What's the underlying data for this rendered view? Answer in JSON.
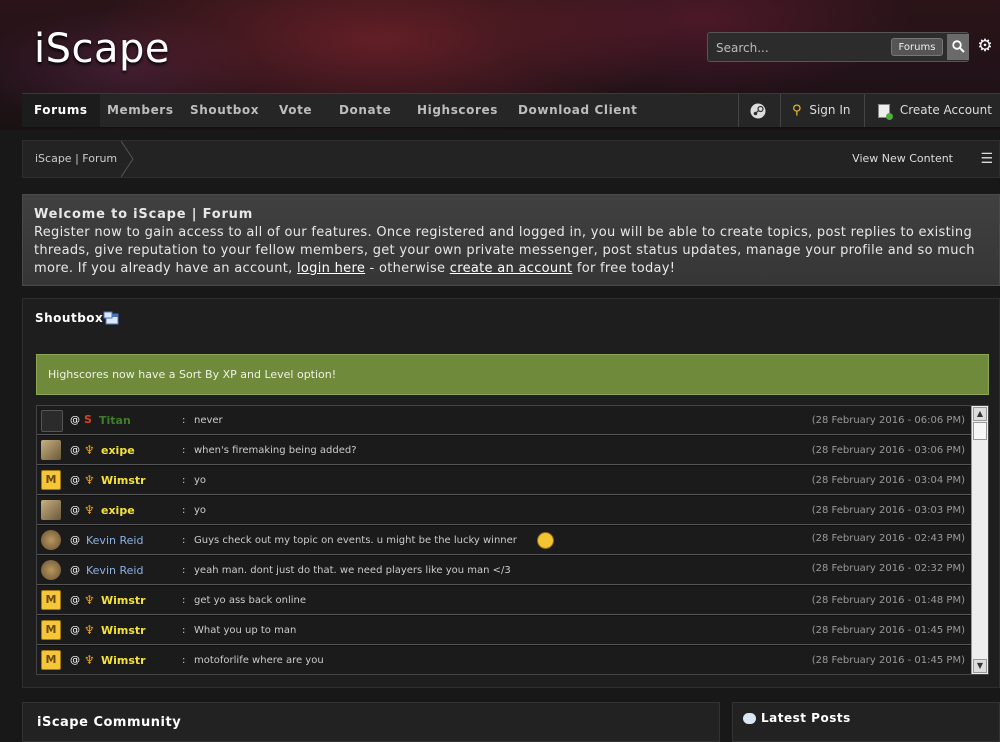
{
  "site": {
    "logo": "iScape"
  },
  "search": {
    "placeholder": "Search...",
    "scope": "Forums"
  },
  "nav": {
    "items": [
      "Forums",
      "Members",
      "Shoutbox",
      "Vote",
      "Donate",
      "Highscores",
      "Download Client"
    ],
    "sign_in": "Sign In",
    "create_account": "Create Account"
  },
  "breadcrumb": {
    "current": "iScape | Forum",
    "view_new": "View New Content"
  },
  "welcome": {
    "title": "Welcome to iScape | Forum",
    "line1": "Register now to gain access to all of our features. Once registered and logged in, you will be able to create topics, post replies to existing",
    "line2": "threads, give reputation to your fellow members, get your own private messenger, post status updates, manage your profile and so much",
    "line3_a": "more. If you already have an account, ",
    "login_link": "login here",
    "line3_b": " - otherwise ",
    "create_link": "create an account",
    "line3_c": " for free today!"
  },
  "shoutbox": {
    "title": "Shoutbox",
    "announcement": "Highscores now have a Sort By XP and Level option!",
    "shouts": [
      {
        "user": "Titan",
        "at": "@",
        "colon": ":",
        "message": "never",
        "time": "(28 February 2016 - 06:06 PM)"
      },
      {
        "user": "exipe",
        "at": "@",
        "colon": ":",
        "message": "when's firemaking being added?",
        "time": "(28 February 2016 - 03:06 PM)"
      },
      {
        "user": "Wimstr",
        "at": "@",
        "colon": ":",
        "message": "yo",
        "time": "(28 February 2016 - 03:04 PM)"
      },
      {
        "user": "exipe",
        "at": "@",
        "colon": ":",
        "message": "yo",
        "time": "(28 February 2016 - 03:03 PM)"
      },
      {
        "user": "Kevin Reid",
        "at": "@",
        "colon": ":",
        "message": "Guys check out my topic on events. u might be the lucky winner",
        "time": "(28 February 2016 - 02:43 PM)"
      },
      {
        "user": "Kevin Reid",
        "at": "@",
        "colon": ":",
        "message": "yeah man. dont just do that. we need players like you man </3",
        "time": "(28 February 2016 - 02:32 PM)"
      },
      {
        "user": "Wimstr",
        "at": "@",
        "colon": ":",
        "message": "get yo ass back online",
        "time": "(28 February 2016 - 01:48 PM)"
      },
      {
        "user": "Wimstr",
        "at": "@",
        "colon": ":",
        "message": "What you up to man",
        "time": "(28 February 2016 - 01:45 PM)"
      },
      {
        "user": "Wimstr",
        "at": "@",
        "colon": ":",
        "message": "motoforlife where are you",
        "time": "(28 February 2016 - 01:45 PM)"
      }
    ]
  },
  "community": {
    "title": "iScape Community"
  },
  "latest_posts": {
    "title": "Latest Posts"
  },
  "colors": {
    "accent_gold": "#f5e23a",
    "announce_green": "#6f8a3b",
    "member_blue": "#8fb0e6"
  }
}
